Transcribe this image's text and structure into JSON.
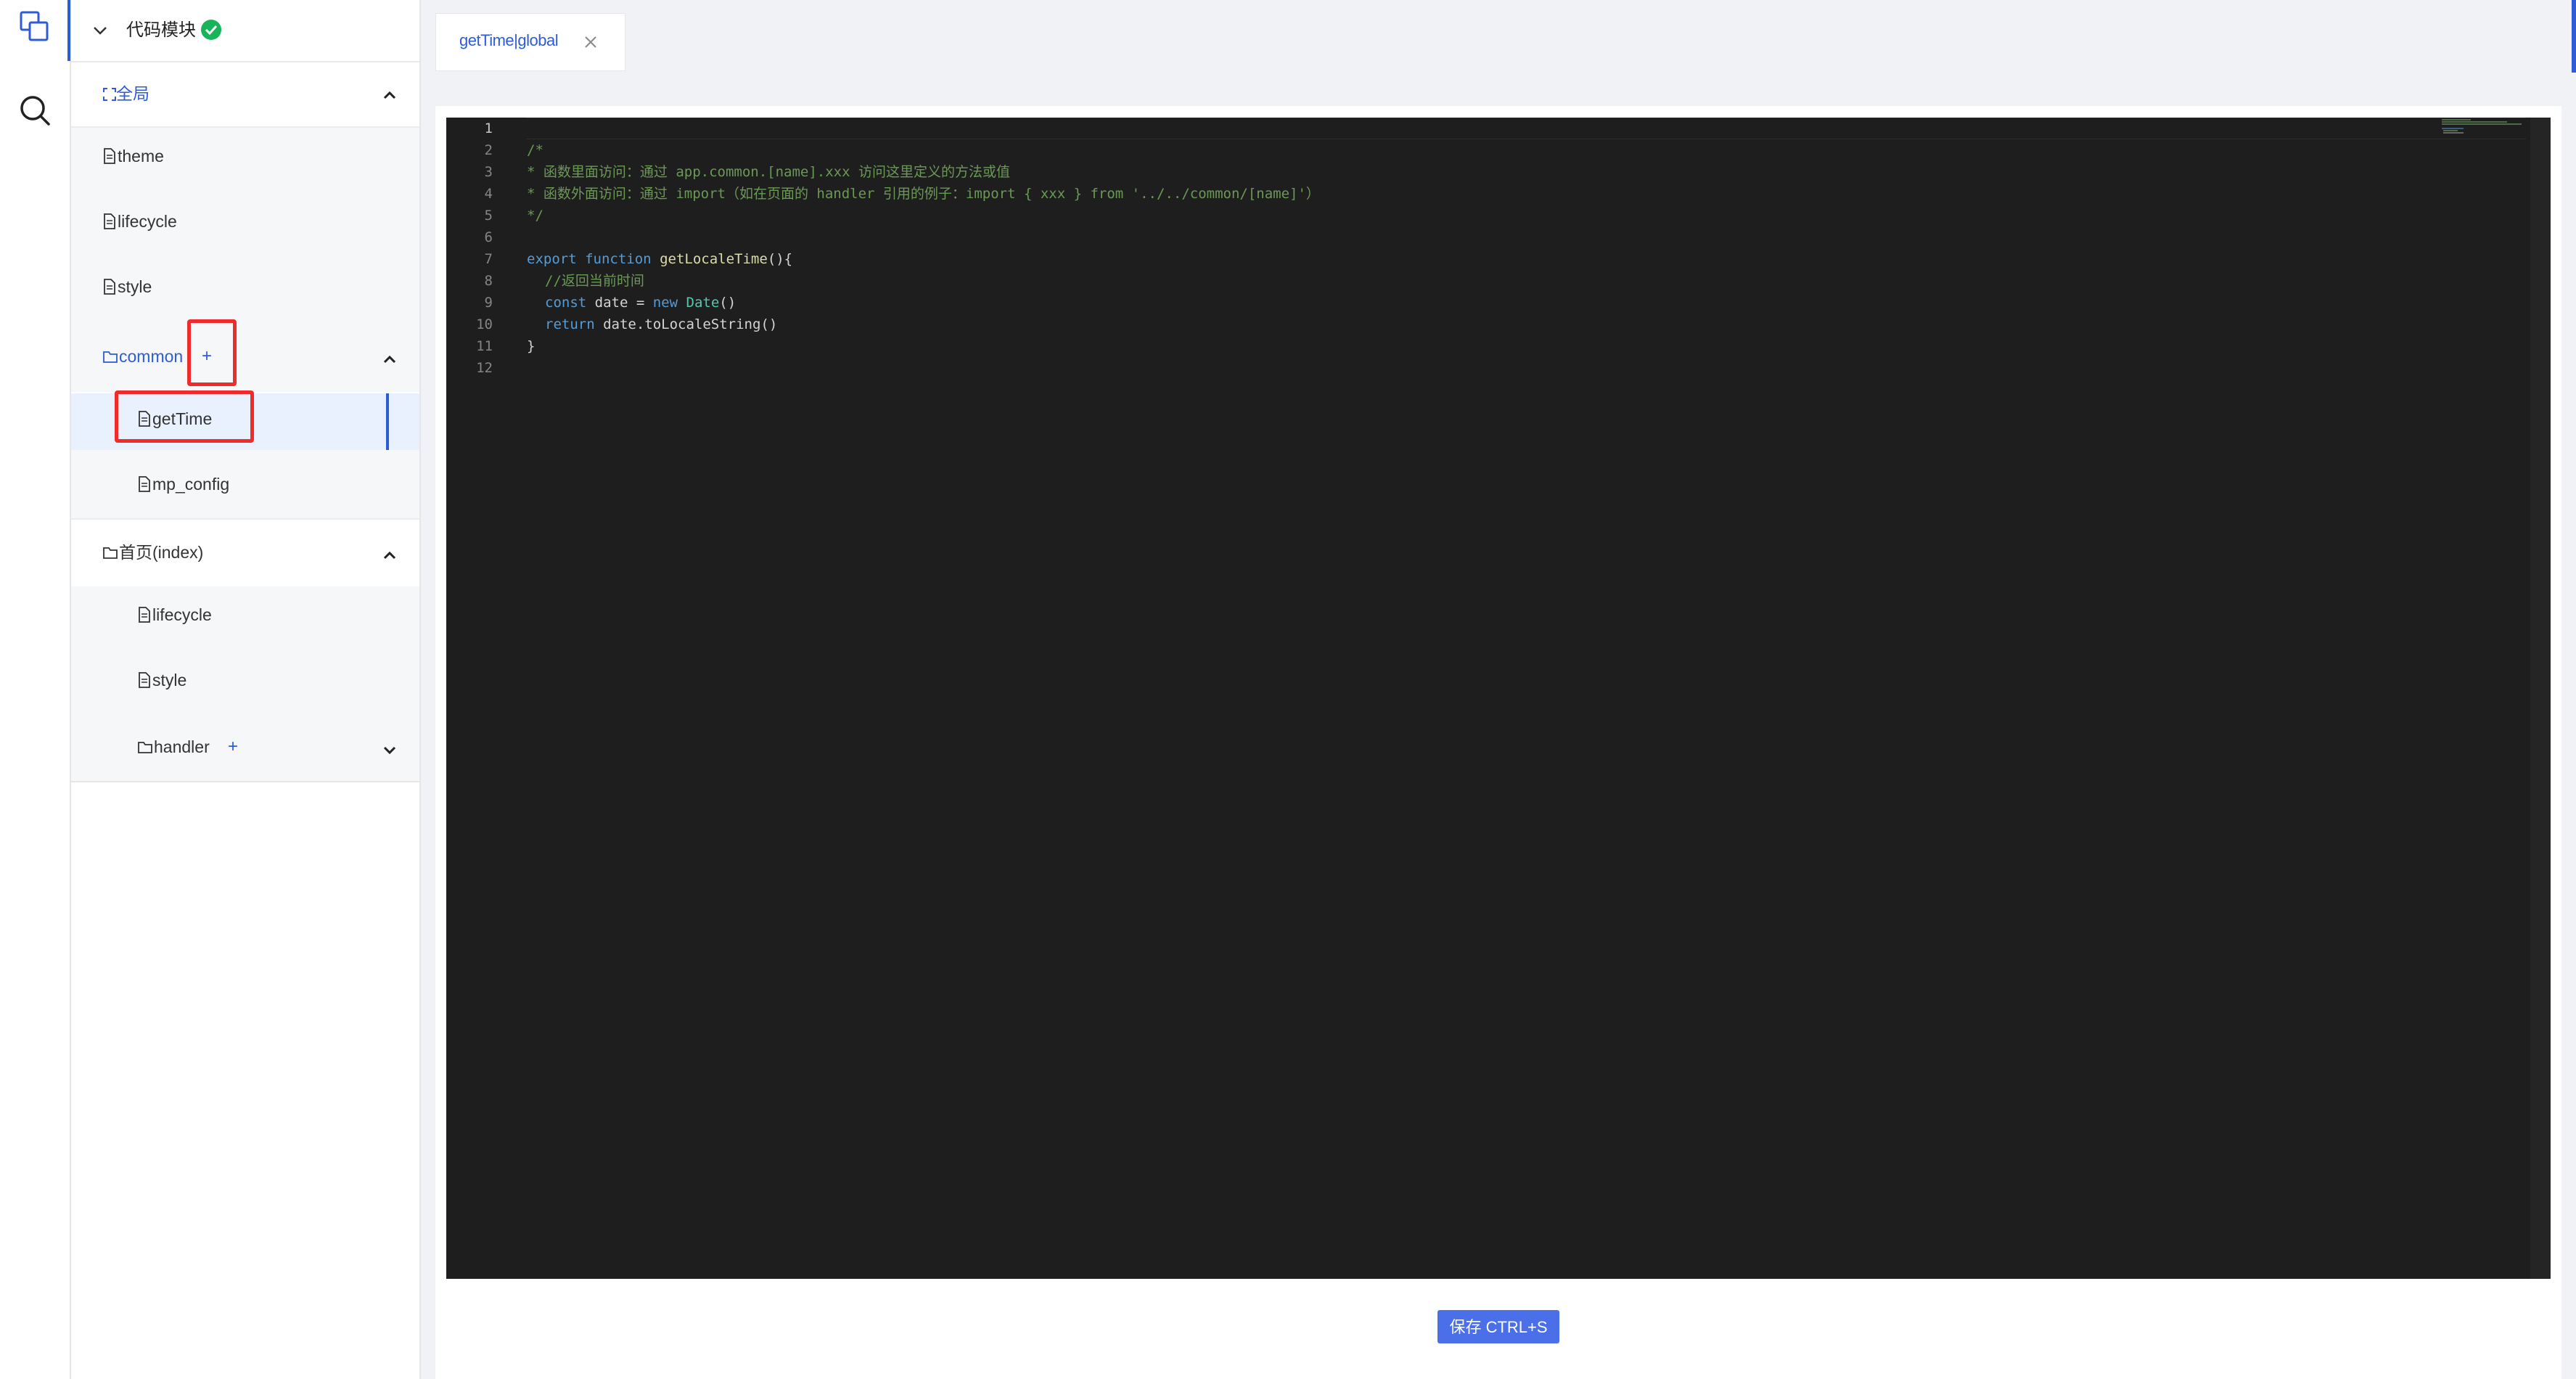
{
  "activity_bar": {
    "icons": [
      "copy-icon",
      "search-icon"
    ]
  },
  "sidebar": {
    "module_title": "代码模块",
    "status": "ok",
    "sections": {
      "global_label": "全局",
      "global_items": [
        "theme",
        "lifecycle",
        "style"
      ],
      "common_label": "common",
      "common_items": [
        "getTime",
        "mp_config"
      ],
      "index_label": "首页(index)",
      "index_items": [
        "lifecycle",
        "style"
      ],
      "index_handler_label": "handler"
    },
    "plus_symbol": "+"
  },
  "tab": {
    "label": "getTime|global",
    "close_symbol": "×"
  },
  "editor": {
    "line_numbers": [
      "1",
      "2",
      "3",
      "4",
      "5",
      "6",
      "7",
      "8",
      "9",
      "10",
      "11",
      "12"
    ],
    "lines": {
      "l2": "/*",
      "l3": "* 函数里面访问：通过 app.common.[name].xxx 访问这里定义的方法或值",
      "l4": "* 函数外面访问：通过 import（如在页面的 handler 引用的例子：import { xxx } from '../../common/[name]'）",
      "l5": "*/",
      "l7_kw1": "export",
      "l7_kw2": "function",
      "l7_fn": "getLocaleTime",
      "l7_rest": "(){",
      "l8": "//返回当前时间",
      "l9_kw": "const",
      "l9_mid": " date = ",
      "l9_new": "new",
      "l9_cls": "Date",
      "l9_end": "()",
      "l10_kw": "return",
      "l10_rest": " date.toLocaleString()",
      "l11": "}"
    },
    "colors": {
      "background": "#1e1e1e",
      "comment": "#6a9955",
      "keyword": "#569cd6",
      "function": "#dcdcaa",
      "class": "#4ec9b0"
    }
  },
  "footer": {
    "save_label": "保存 CTRL+S"
  },
  "accent_color": "#2e5bd6",
  "highlight_color": "#f02b2b"
}
